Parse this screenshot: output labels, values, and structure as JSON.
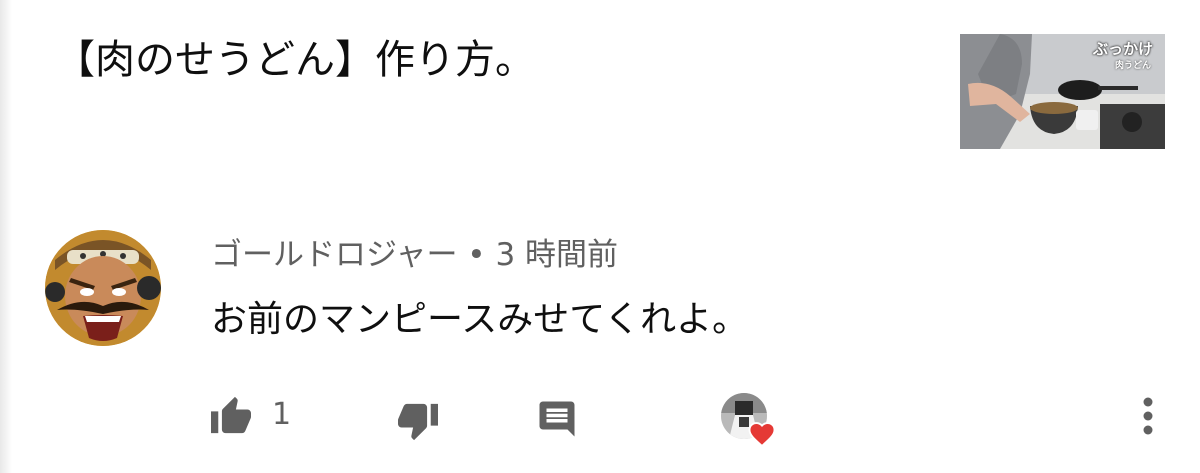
{
  "video": {
    "title": "【肉のせうどん】作り方。",
    "thumbnail_text_main": "ぶっかけ",
    "thumbnail_text_sub": "肉うどん"
  },
  "comment": {
    "author": "ゴールドロジャー",
    "separator": " • ",
    "time": "3 時間前",
    "text": "お前のマンピースみせてくれよ。",
    "like_count": "1",
    "creator_hearted": true
  },
  "icons": {
    "like": "thumbs-up-icon",
    "dislike": "thumbs-down-icon",
    "reply": "comment-reply-icon",
    "heart": "heart-icon",
    "more": "more-vertical-icon"
  },
  "colors": {
    "primary_text": "#0f0f0f",
    "secondary_text": "#606060",
    "icon_gray": "#606060",
    "heart_red": "#e53935"
  }
}
